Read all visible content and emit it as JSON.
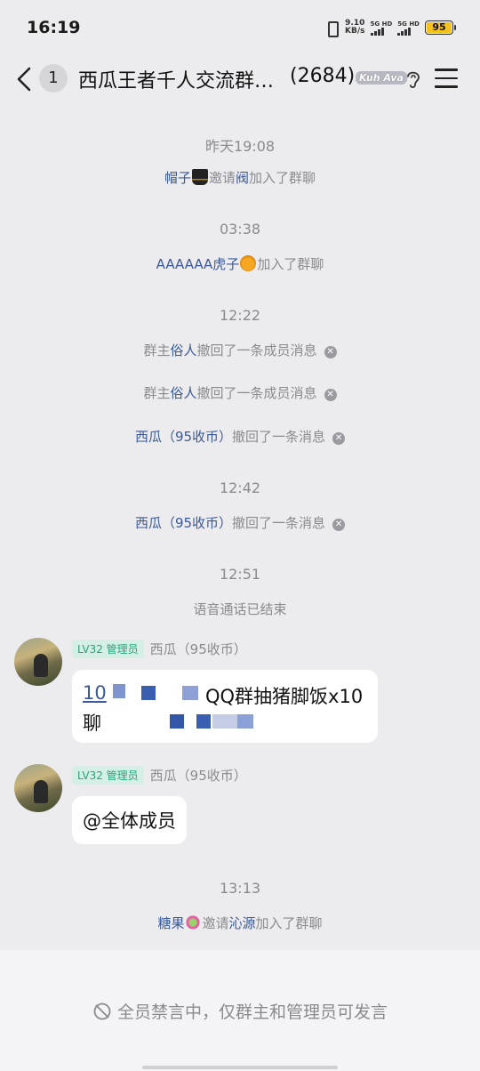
{
  "status_bar": {
    "time": "16:19",
    "net_speed_value": "9.10",
    "net_speed_unit": "KB/s",
    "sim1": "5G HD",
    "sim2": "5G HD",
    "battery": "95"
  },
  "header": {
    "unread_count": "1",
    "title": "西瓜王者千人交流群…",
    "member_count": "(2684)",
    "level_logo": "Kuh Ava"
  },
  "messages": {
    "ts1": "昨天19:08",
    "join1": {
      "user": "帽子",
      "text1": "邀请",
      "invitee": "阀",
      "text2": "加入了群聊"
    },
    "ts2": "03:38",
    "join2": {
      "user": "AAAAAA虎子",
      "text": "加入了群聊"
    },
    "ts3": "12:22",
    "recall1": {
      "prefix": "群主",
      "user": "俗人",
      "text": "撤回了一条成员消息"
    },
    "recall2": {
      "prefix": "群主",
      "user": "俗人",
      "text": "撤回了一条成员消息"
    },
    "recall3": {
      "user": "西瓜（95收币）",
      "text": "撤回了一条消息"
    },
    "ts4": "12:42",
    "recall4": {
      "user": "西瓜（95收币）",
      "text": "撤回了一条消息"
    },
    "ts5": "12:51",
    "call_ended": "语音通话已结束",
    "msg1": {
      "role": "LV32 管理员",
      "sender": "西瓜（95收币）",
      "line1_visible": "QQ群抽猪脚饭x10",
      "line1_prefix": "10",
      "line2_prefix": "聊"
    },
    "msg2": {
      "role": "LV32 管理员",
      "sender": "西瓜（95收币）",
      "text": "@全体成员"
    },
    "ts6": "13:13",
    "join3": {
      "user": "糖果",
      "text1": "邀请",
      "invitee": "沁源",
      "text2": "加入了群聊"
    }
  },
  "footer": {
    "muted_notice": "全员禁言中，仅群主和管理员可发言"
  }
}
